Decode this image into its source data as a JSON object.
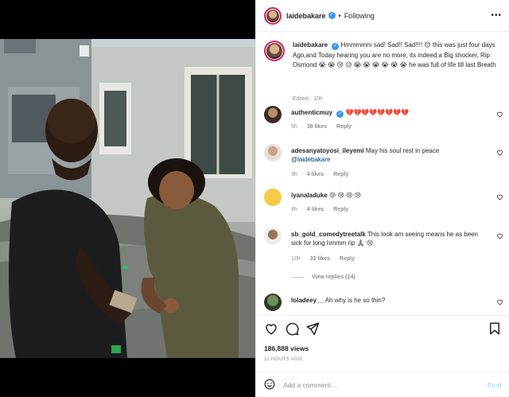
{
  "header": {
    "username": "laidebakare",
    "follow_state": "Following",
    "more_icon": "more-dots-icon"
  },
  "caption": {
    "username": "laidebakare",
    "text": "Hmmmmm sad! Sad!! Sad!!!! 😔 this was just four days Ago,and Today hearing you are no more, its indeed a Big shocker, Rip Osmond 😭 😭 😢 😥 😭 😭 😭 😭 😭 😭 he was full of life till last Breath",
    "meta": "Edited · 10h"
  },
  "comments": [
    {
      "username": "authenticmuy",
      "text": "💔💔💔💔💔💔💔💔",
      "time": "5h",
      "likes": "38 likes",
      "reply": "Reply"
    },
    {
      "username": "adesanyatoyosi_ileyemi",
      "text": "May his soul rest in peace",
      "mention": "@laidebakare",
      "time": "3h",
      "likes": "4 likes",
      "reply": "Reply"
    },
    {
      "username": "iyanaladuke",
      "text": "😢 😢 😢 😢",
      "time": "4h",
      "likes": "4 likes",
      "reply": "Reply"
    },
    {
      "username": "sb_gold_comedytreetalk",
      "text": "This look am seeing means he as been sick for long hmmm rip 🙏🏽 😢",
      "time": "10h",
      "likes": "33 likes",
      "reply": "Reply",
      "view_replies": "View replies (14)"
    },
    {
      "username": "loladeey__",
      "text": "Ah why is he so thin?",
      "time": "",
      "likes": "",
      "reply": ""
    }
  ],
  "actions": {
    "like_icon": "heart-icon",
    "comment_icon": "comment-icon",
    "share_icon": "paper-plane-icon",
    "save_icon": "bookmark-icon"
  },
  "stats": {
    "views": "186,888 views",
    "posted": "11 HOURS AGO"
  },
  "add_comment": {
    "placeholder": "Add a comment…",
    "post_label": "Post"
  },
  "colors": {
    "verified": "#3897f0",
    "story_ring": "#d62976",
    "heart": "#ed4956",
    "post_disabled": "#b2dffc"
  }
}
